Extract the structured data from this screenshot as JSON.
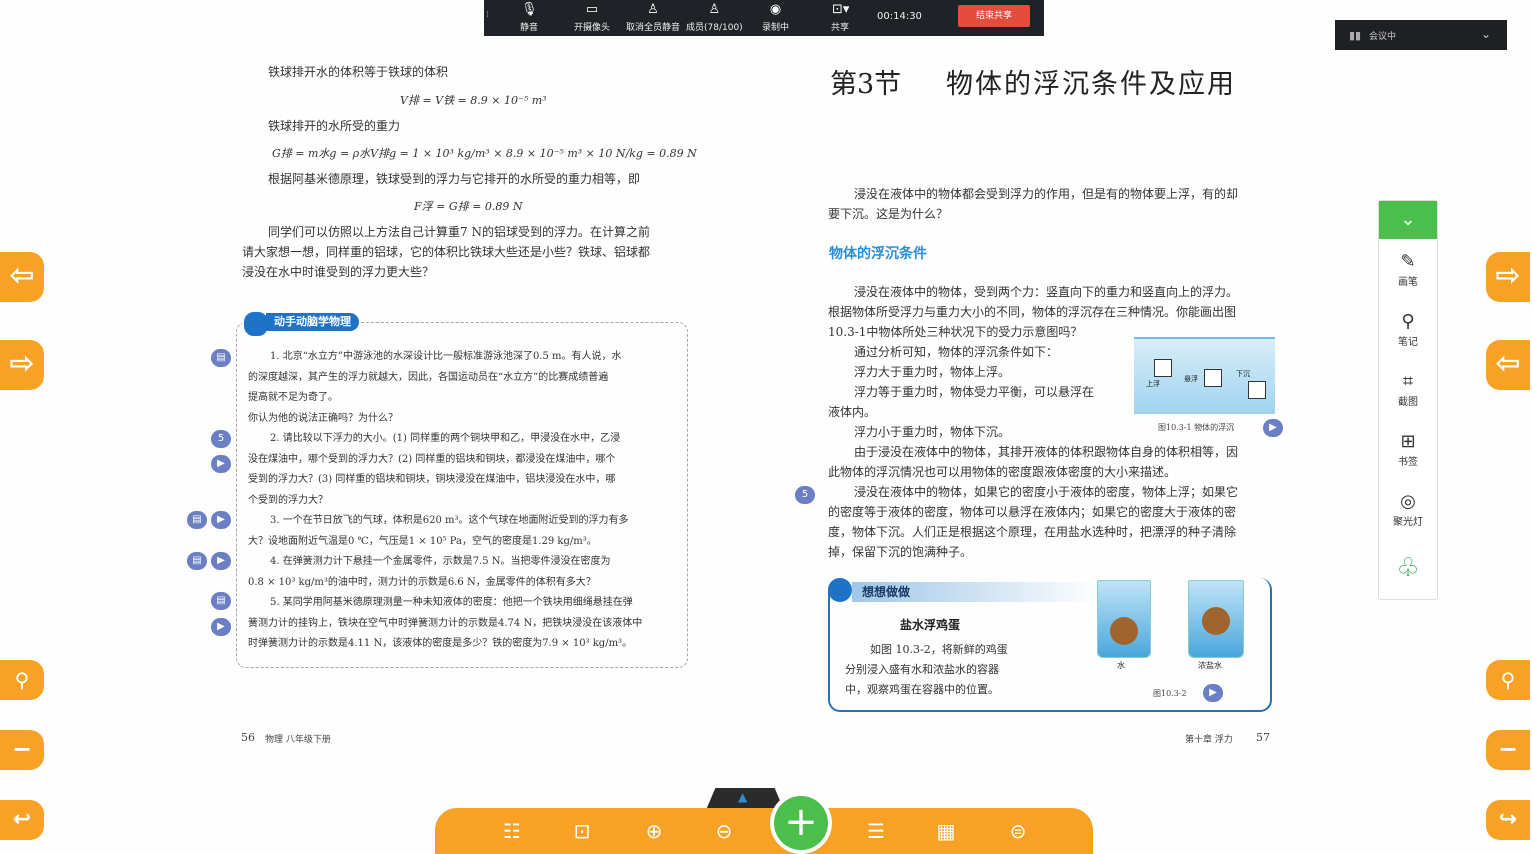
{
  "meeting_toolbar": {
    "items": [
      {
        "label": "静音",
        "icon": "microphone-icon"
      },
      {
        "label": "开摄像头",
        "icon": "camera-off-icon"
      },
      {
        "label": "取消全员静音",
        "icon": "mute-all-icon"
      },
      {
        "label": "成员(78/100)",
        "icon": "members-icon"
      },
      {
        "label": "录制中",
        "icon": "record-icon"
      },
      {
        "label": "共享",
        "icon": "share-icon"
      }
    ],
    "timer": "00:14:30",
    "end_share": "结束共享"
  },
  "status": {
    "label": "会议中"
  },
  "left_page": {
    "p1": "铁球排开水的体积等于铁球的体积",
    "eq1": "V排 = V铁 = 8.9 × 10⁻⁵ m³",
    "p2": "铁球排开的水所受的重力",
    "eq2": "G排 = m水g = ρ水V排g = 1 × 10³ kg/m³ × 8.9 × 10⁻⁵ m³ × 10 N/kg = 0.89 N",
    "p3": "根据阿基米德原理，铁球受到的浮力与它排开的水所受的重力相等，即",
    "eq3": "F浮 = G排 = 0.89 N",
    "p4a": "同学们可以仿照以上方法自己计算重7 N的铝球受到的浮力。在计算之前",
    "p4b": "请大家想一想，同样重的铝球，它的体积比铁球大些还是小些？铁球、铝球都",
    "p4c": "浸没在水中时谁受到的浮力更大些？",
    "box_title": "动手动脑学物理",
    "ex_lines": [
      "1. 北京“水立方”中游泳池的水深设计比一般标准游泳池深了0.5 m。有人说，水",
      "的深度越深，其产生的浮力就越大，因此，各国运动员在“水立方”的比赛成绩普遍",
      "提高就不足为奇了。",
      "你认为他的说法正确吗？为什么？",
      "2. 请比较以下浮力的大小。(1) 同样重的两个铜块甲和乙，甲浸没在水中，乙浸",
      "没在煤油中，哪个受到的浮力大？(2) 同样重的铝块和铜块，都浸没在煤油中，哪个",
      "受到的浮力大？(3) 同样重的铝块和铜块，铜块浸没在煤油中，铝块浸没在水中，哪",
      "个受到的浮力大？",
      "3. 一个在节日放飞的气球，体积是620 m³。这个气球在地面附近受到的浮力有多",
      "大？设地面附近气温是0 ℃，气压是1 × 10⁵ Pa，空气的密度是1.29 kg/m³。",
      "4. 在弹簧测力计下悬挂一个金属零件，示数是7.5 N。当把零件浸没在密度为",
      "0.8 × 10³ kg/m³的油中时，测力计的示数是6.6 N，金属零件的体积有多大？",
      "5. 某同学用阿基米德原理测量一种未知液体的密度：他把一个铁块用细绳悬挂在弹",
      "簧测力计的挂钩上，铁块在空气中时弹簧测力计的示数是4.74 N，把铁块浸没在该液体中",
      "时弹簧测力计的示数是4.11 N，该液体的密度是多少？铁的密度为7.9 × 10³ kg/m³。"
    ],
    "footer_num": "56",
    "footer_text": "物理  八年级下册"
  },
  "right_page": {
    "title_num": "第3节",
    "title": "物体的浮沉条件及应用",
    "intro1": "浸没在液体中的物体都会受到浮力的作用，但是有的物体要上浮，有的却",
    "intro2": "要下沉。这是为什么？",
    "heading": "物体的浮沉条件",
    "body": [
      "浸没在液体中的物体，受到两个力：竖直向下的重力和竖直向上的浮力。",
      "根据物体所受浮力与重力大小的不同，物体的浮沉存在三种情况。你能画出图",
      "10.3-1中物体所处三种状况下的受力示意图吗？",
      "通过分析可知，物体的浮沉条件如下：",
      "浮力大于重力时，物体上浮。",
      "浮力等于重力时，物体受力平衡，可以悬浮在",
      "液体内。",
      "浮力小于重力时，物体下沉。",
      "由于浸没在液体中的物体，其排开液体的体积跟物体自身的体积相等，因",
      "此物体的浮沉情况也可以用物体的密度跟液体密度的大小来描述。",
      "浸没在液体中的物体，如果它的密度小于液体的密度，物体上浮；如果它",
      "的密度等于液体的密度，物体可以悬浮在液体内；如果它的密度大于液体的密",
      "度，物体下沉。人们正是根据这个原理，在用盐水选种时，把漂浮的种子清除",
      "掉，保留下沉的饱满种子。"
    ],
    "fig1_labels": {
      "up": "上浮",
      "mid": "悬浮",
      "down": "下沉"
    },
    "fig1_caption": "图10.3-1   物体的浮沉",
    "box_title": "想想做做",
    "box_sub": "盐水浮鸡蛋",
    "box_lines": [
      "如图 10.3-2，将新鲜的鸡蛋",
      "分别浸入盛有水和浓盐水的容器",
      "中，观察鸡蛋在容器中的位置。"
    ],
    "fig2_labels": {
      "water": "水",
      "salt": "浓盐水"
    },
    "fig2_caption": "图10.3-2",
    "footer_text": "第十章  浮力",
    "footer_num": "57"
  },
  "tools": [
    {
      "label": "画笔",
      "icon": "pen-icon"
    },
    {
      "label": "笔记",
      "icon": "pin-icon"
    },
    {
      "label": "截图",
      "icon": "crop-icon"
    },
    {
      "label": "书签",
      "icon": "bookmark-icon"
    },
    {
      "label": "聚光灯",
      "icon": "spotlight-icon"
    }
  ],
  "colors": {
    "accent": "#f7a225",
    "tool_green": "#4cbe4c",
    "heading_blue": "#2a8fd6",
    "meeting_bar": "#1f2226",
    "end_red": "#e24d3d"
  }
}
